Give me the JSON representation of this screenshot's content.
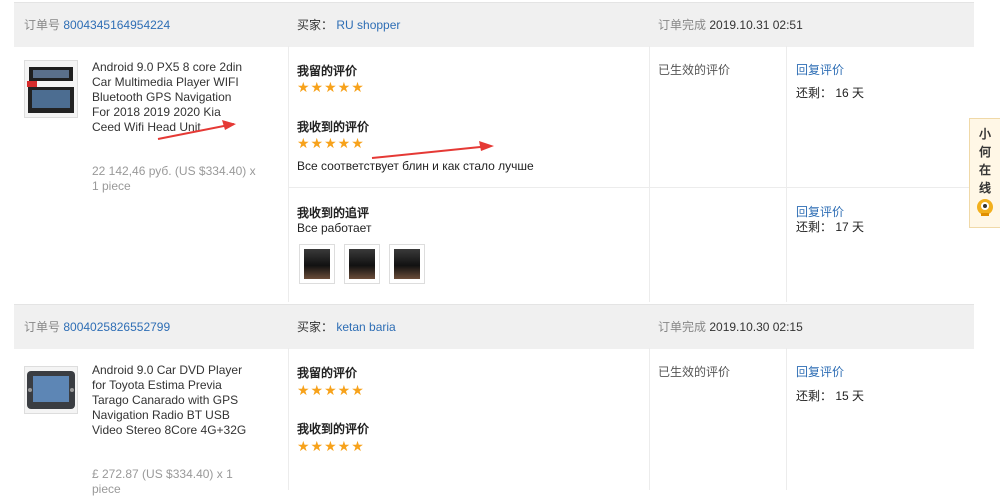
{
  "orders": [
    {
      "order_no_label": "订单号",
      "order_no": "8004345164954224",
      "buyer_label": "买家：",
      "buyer": "RU shopper",
      "status_label": "订单完成",
      "status_time": "2019.10.31 02:51",
      "product_title": "Android 9.0 PX5 8 core 2din Car Multimedia Player WIFI Bluetooth GPS Navigation For 2018 2019 2020 Kia Ceed Wifi Head Unit",
      "price": "22 142,46 руб. (US $334.40) x 1 piece",
      "my_review_label": "我留的评价",
      "my_review_stars": "★★★★★",
      "received_review_label": "我收到的评价",
      "received_review_stars": "★★★★★",
      "received_review_text": "Все соответствует блин и как стало лучше",
      "effective_label": "已生效的评价",
      "reply_link": "回复评价",
      "remaining": "还剩： 16 天",
      "followup_label": "我收到的追评",
      "followup_text": "Все работает",
      "followup_reply_link": "回复评价",
      "followup_remaining": "还剩： 17 天"
    },
    {
      "order_no_label": "订单号",
      "order_no": "8004025826552799",
      "buyer_label": "买家：",
      "buyer": "ketan baria",
      "status_label": "订单完成",
      "status_time": "2019.10.30 02:15",
      "product_title": "Android 9.0 Car DVD Player for Toyota Estima Previa Tarago Canarado with GPS Navigation Radio BT USB Video Stereo 8Core 4G+32G",
      "price": "£ 272.87 (US $334.40) x 1 piece",
      "my_review_label": "我留的评价",
      "my_review_stars": "★★★★★",
      "received_review_label": "我收到的评价",
      "received_review_stars": "★★★★★",
      "effective_label": "已生效的评价",
      "reply_link": "回复评价",
      "remaining": "还剩： 15 天"
    }
  ],
  "side_widget": {
    "text": [
      "小",
      "何",
      "在",
      "线"
    ],
    "icon": "chat-mascot-icon"
  },
  "colors": {
    "link": "#2e6eb5",
    "star": "#f7a21b",
    "arrow": "#e53935",
    "header_bg": "#f0f0f0"
  }
}
